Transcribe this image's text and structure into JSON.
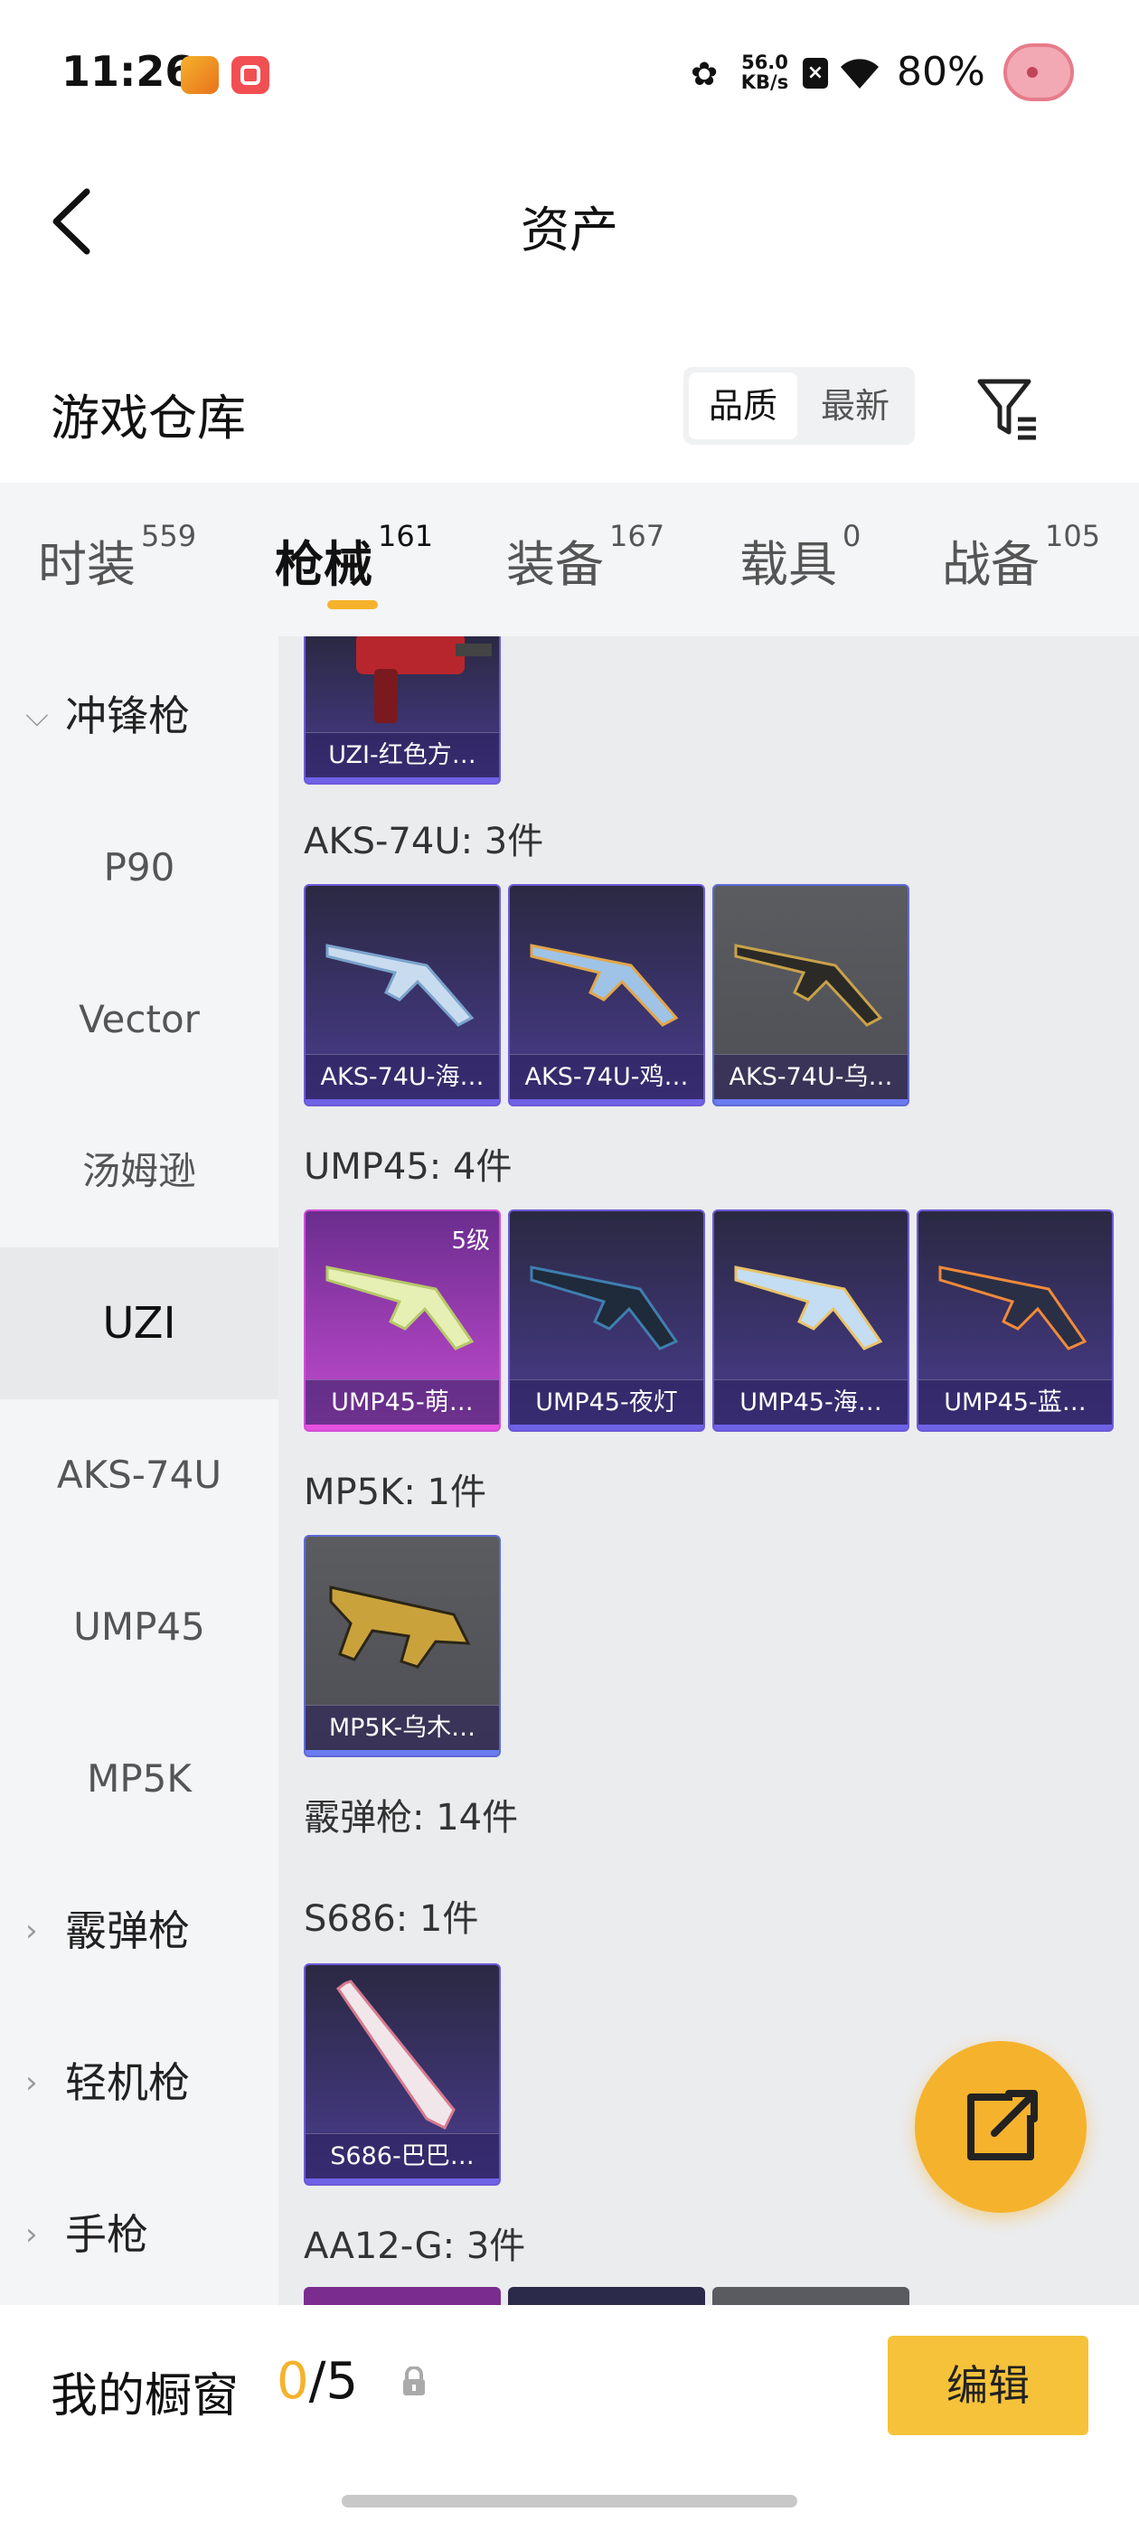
{
  "status_bar": {
    "time": "11:26",
    "net_speed_value": "56.0",
    "net_speed_unit": "KB/s",
    "battery": "80%",
    "icons": [
      "app-badge-icon",
      "app-badge-icon",
      "flower-icon",
      "no-sim-icon",
      "wifi-icon"
    ]
  },
  "header": {
    "title": "资产"
  },
  "warehouse": {
    "title": "游戏仓库",
    "sort_options": [
      "品质",
      "最新"
    ],
    "sort_selected": "品质"
  },
  "tabs": [
    {
      "label": "时装",
      "count": "559"
    },
    {
      "label": "枪械",
      "count": "161",
      "active": true
    },
    {
      "label": "装备",
      "count": "167"
    },
    {
      "label": "载具",
      "count": "0"
    },
    {
      "label": "战备",
      "count": "105"
    }
  ],
  "sidebar": [
    {
      "label": "冲锋枪",
      "type": "category",
      "expanded": true
    },
    {
      "label": "P90",
      "type": "item"
    },
    {
      "label": "Vector",
      "type": "item"
    },
    {
      "label": "汤姆逊",
      "type": "item"
    },
    {
      "label": "UZI",
      "type": "item",
      "selected": true
    },
    {
      "label": "AKS-74U",
      "type": "item"
    },
    {
      "label": "UMP45",
      "type": "item"
    },
    {
      "label": "MP5K",
      "type": "item"
    },
    {
      "label": "霰弹枪",
      "type": "category",
      "expanded": false
    },
    {
      "label": "轻机枪",
      "type": "category",
      "expanded": false
    },
    {
      "label": "手枪",
      "type": "category",
      "expanded": false
    }
  ],
  "content": {
    "uzi_partial_card": {
      "name": "UZI-红色方…",
      "rarity": "purple"
    },
    "groups": [
      {
        "label": "AKS-74U: 3件",
        "items": [
          {
            "name": "AKS-74U-海…",
            "rarity": "purple"
          },
          {
            "name": "AKS-74U-鸡…",
            "rarity": "purple"
          },
          {
            "name": "AKS-74U-乌…",
            "rarity": "gray"
          }
        ]
      },
      {
        "label": "UMP45: 4件",
        "items": [
          {
            "name": "UMP45-萌…",
            "rarity": "pink",
            "level": "5级"
          },
          {
            "name": "UMP45-夜灯",
            "rarity": "purple"
          },
          {
            "name": "UMP45-海…",
            "rarity": "purple"
          },
          {
            "name": "UMP45-蓝…",
            "rarity": "purple"
          }
        ]
      },
      {
        "label": "MP5K: 1件",
        "items": [
          {
            "name": "MP5K-乌木…",
            "rarity": "gray"
          }
        ]
      }
    ],
    "shotgun_label": "霰弹枪: 14件",
    "s686_label": "S686: 1件",
    "s686_card": {
      "name": "S686-巴巴…",
      "rarity": "purple"
    },
    "aa12_label": "AA12-G: 3件"
  },
  "bottom": {
    "window_label": "我的橱窗",
    "window_used": "0",
    "window_total": "/5",
    "edit_label": "编辑"
  },
  "colors": {
    "accent": "#f5b22c",
    "rarity_purple": "#6c5ad8",
    "rarity_pink": "#d24fd8",
    "rarity_gray": "#5e6ad6"
  }
}
